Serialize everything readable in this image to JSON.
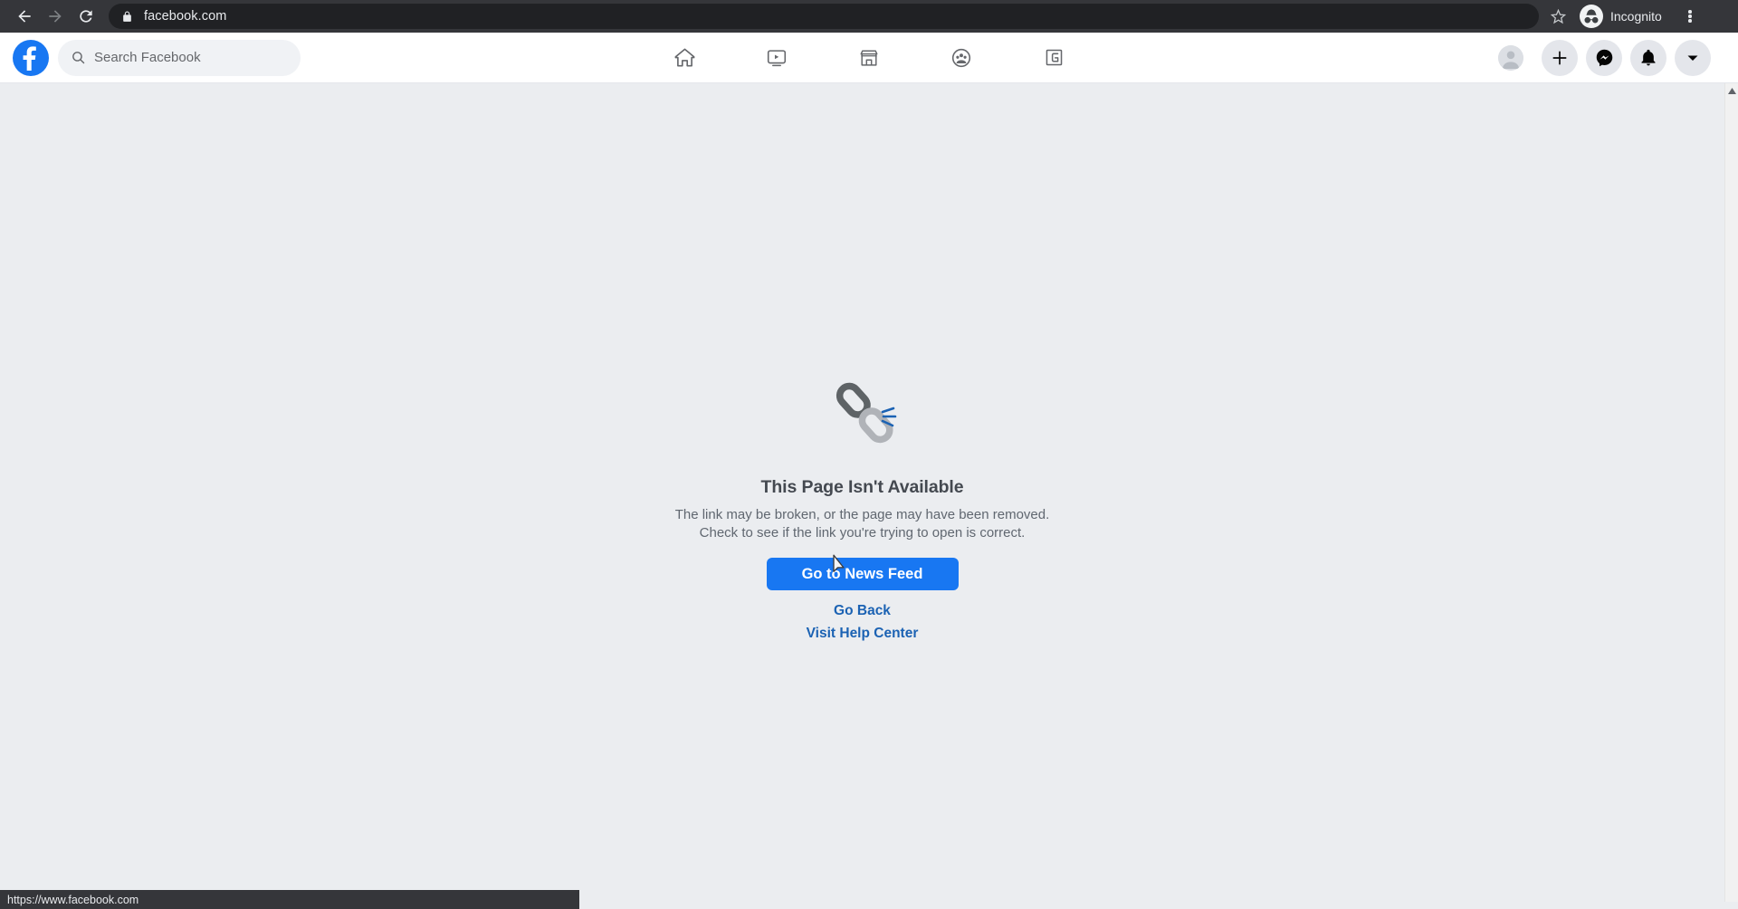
{
  "browser": {
    "back_icon": "arrow-left-icon",
    "forward_icon": "arrow-right-icon",
    "reload_icon": "reload-icon",
    "lock_icon": "lock-icon",
    "url": "facebook.com",
    "star_icon": "star-icon",
    "incognito_label": "Incognito",
    "incognito_icon": "incognito-hat-icon",
    "menu_icon": "kebab-menu-icon",
    "status_url": "https://www.facebook.com"
  },
  "fb_header": {
    "logo_letter": "f",
    "search": {
      "placeholder": "Search Facebook",
      "value": "",
      "icon": "search-icon"
    },
    "nav": [
      {
        "name": "home",
        "icon": "home-icon",
        "label": "Home"
      },
      {
        "name": "watch",
        "icon": "video-play-icon",
        "label": "Watch"
      },
      {
        "name": "marketplace",
        "icon": "storefront-icon",
        "label": "Marketplace"
      },
      {
        "name": "groups",
        "icon": "groups-icon",
        "label": "Groups"
      },
      {
        "name": "gaming",
        "icon": "gaming-icon",
        "label": "Gaming"
      }
    ],
    "actions": [
      {
        "name": "profile-avatar",
        "icon": "avatar-icon"
      },
      {
        "name": "create",
        "icon": "plus-icon"
      },
      {
        "name": "messenger",
        "icon": "messenger-icon"
      },
      {
        "name": "notifications",
        "icon": "bell-icon"
      },
      {
        "name": "account-menu",
        "icon": "chevron-down-icon"
      }
    ]
  },
  "content": {
    "icon": "broken-link-icon",
    "title": "This Page Isn't Available",
    "description": "The link may be broken, or the page may have been removed. Check to see if the link you're trying to open is correct.",
    "primary_button": "Go to News Feed",
    "links": [
      "Go Back",
      "Visit Help Center"
    ]
  },
  "colors": {
    "facebook_blue": "#1877f2",
    "page_background": "#ebedf0",
    "chrome_background": "#35363a",
    "omnibox_background": "#202124",
    "link_color": "#1b62b3"
  },
  "scrollbar": {
    "up_arrow_icon": "caret-up-icon"
  }
}
